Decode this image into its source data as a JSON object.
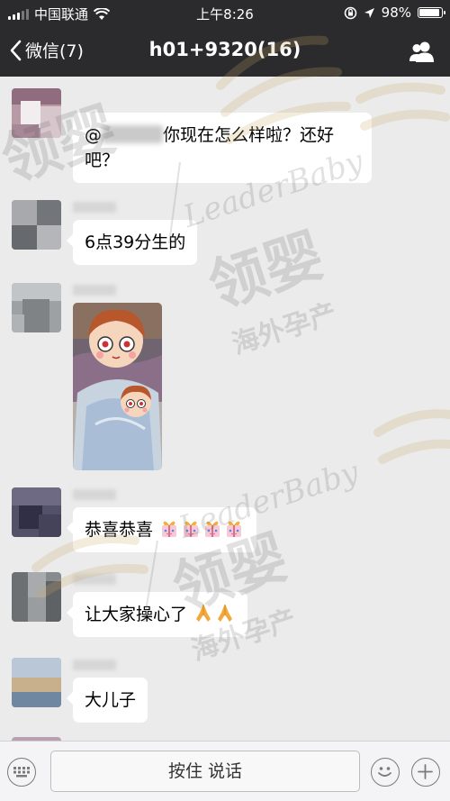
{
  "status_bar": {
    "carrier": "中国联通",
    "time": "上午8:26",
    "battery_percent": "98%",
    "battery_level": 0.98,
    "icons": [
      "signal-icon",
      "wifi-icon",
      "rotation-lock-icon",
      "location-arrow-icon",
      "battery-icon"
    ]
  },
  "nav": {
    "back_label": "微信(7)",
    "title": "h01+9320(16)",
    "right_icon": "group-members-icon"
  },
  "messages": [
    {
      "type": "text",
      "text_before": "@",
      "text_after": "你现在怎么样啦？还好吧？"
    },
    {
      "type": "text",
      "text": "6点39分生的"
    },
    {
      "type": "image"
    },
    {
      "type": "text",
      "text": "恭喜恭喜",
      "emoji": "gift-emoji",
      "emoji_count": 4
    },
    {
      "type": "text",
      "text": "让大家操心了",
      "emoji": "folded-hands-emoji",
      "emoji_count": 2
    },
    {
      "type": "text",
      "text": "大儿子"
    }
  ],
  "watermark": {
    "brand_en": "LeaderBaby",
    "brand_cn": "领婴",
    "slogan_cn": "海外孕产"
  },
  "input_bar": {
    "talk_label": "按住 说话",
    "icons": [
      "keyboard-icon",
      "emoji-icon",
      "plus-icon"
    ]
  },
  "colors": {
    "nav_bg": "#2b2b2e",
    "chat_bg": "#ebebeb",
    "bubble_bg": "#ffffff"
  }
}
